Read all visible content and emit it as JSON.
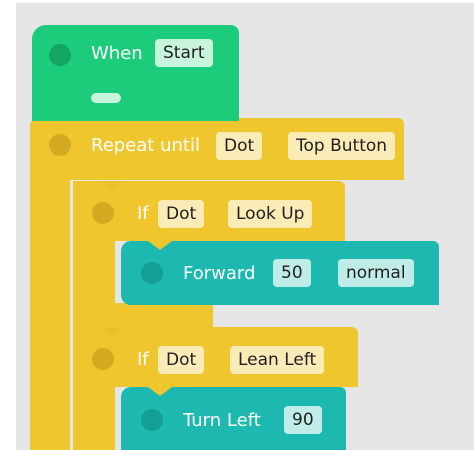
{
  "colors": {
    "green": "#1ccc7b",
    "yellow": "#efc62d",
    "teal": "#1db8b0",
    "canvas_bg": "#e6e6e6"
  },
  "when_block": {
    "keyword": "When",
    "trigger": "Start"
  },
  "repeat_block": {
    "keyword": "Repeat until",
    "target": "Dot",
    "condition": "Top Button"
  },
  "if_block_1": {
    "keyword": "If",
    "target": "Dot",
    "condition": "Look Up"
  },
  "forward_block": {
    "keyword": "Forward",
    "distance": "50",
    "speed": "normal"
  },
  "if_block_2": {
    "keyword": "If",
    "target": "Dot",
    "condition": "Lean Left"
  },
  "turn_block": {
    "keyword": "Turn Left",
    "angle": "90"
  }
}
